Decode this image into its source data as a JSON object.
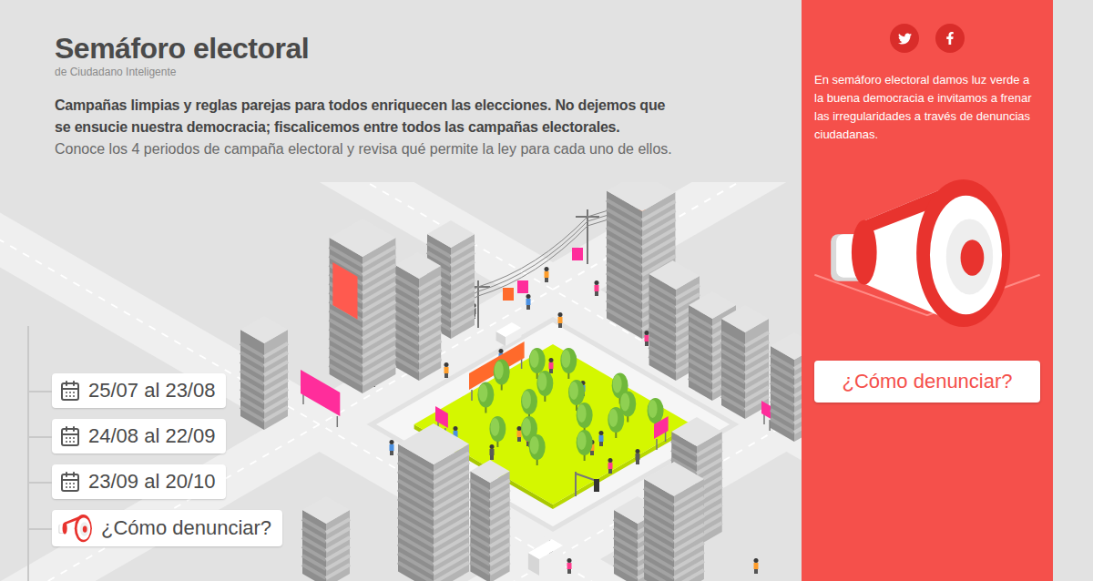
{
  "header": {
    "title": "Semáforo electoral",
    "subtitle": "de Ciudadano Inteligente",
    "lead": "Campañas limpias y reglas parejas para todos enriquecen las elecciones. No dejemos que se ensucie nuestra democracia; fiscalicemos entre todos las campañas electorales.",
    "intro": "Conoce los 4 periodos de campaña electoral y revisa qué permite la ley para cada uno de ellos."
  },
  "periods": [
    {
      "label": "25/07 al 23/08",
      "kind": "period"
    },
    {
      "label": "24/08 al 22/09",
      "kind": "period"
    },
    {
      "label": "23/09 al 20/10",
      "kind": "period"
    },
    {
      "label": "¿Cómo denunciar?",
      "kind": "report"
    }
  ],
  "sidebar": {
    "text": "En semáforo electoral damos luz verde a la buena democracia e invitamos a frenar las irregularidades a través de denuncias ciudadanas.",
    "button": "¿Cómo denunciar?"
  }
}
